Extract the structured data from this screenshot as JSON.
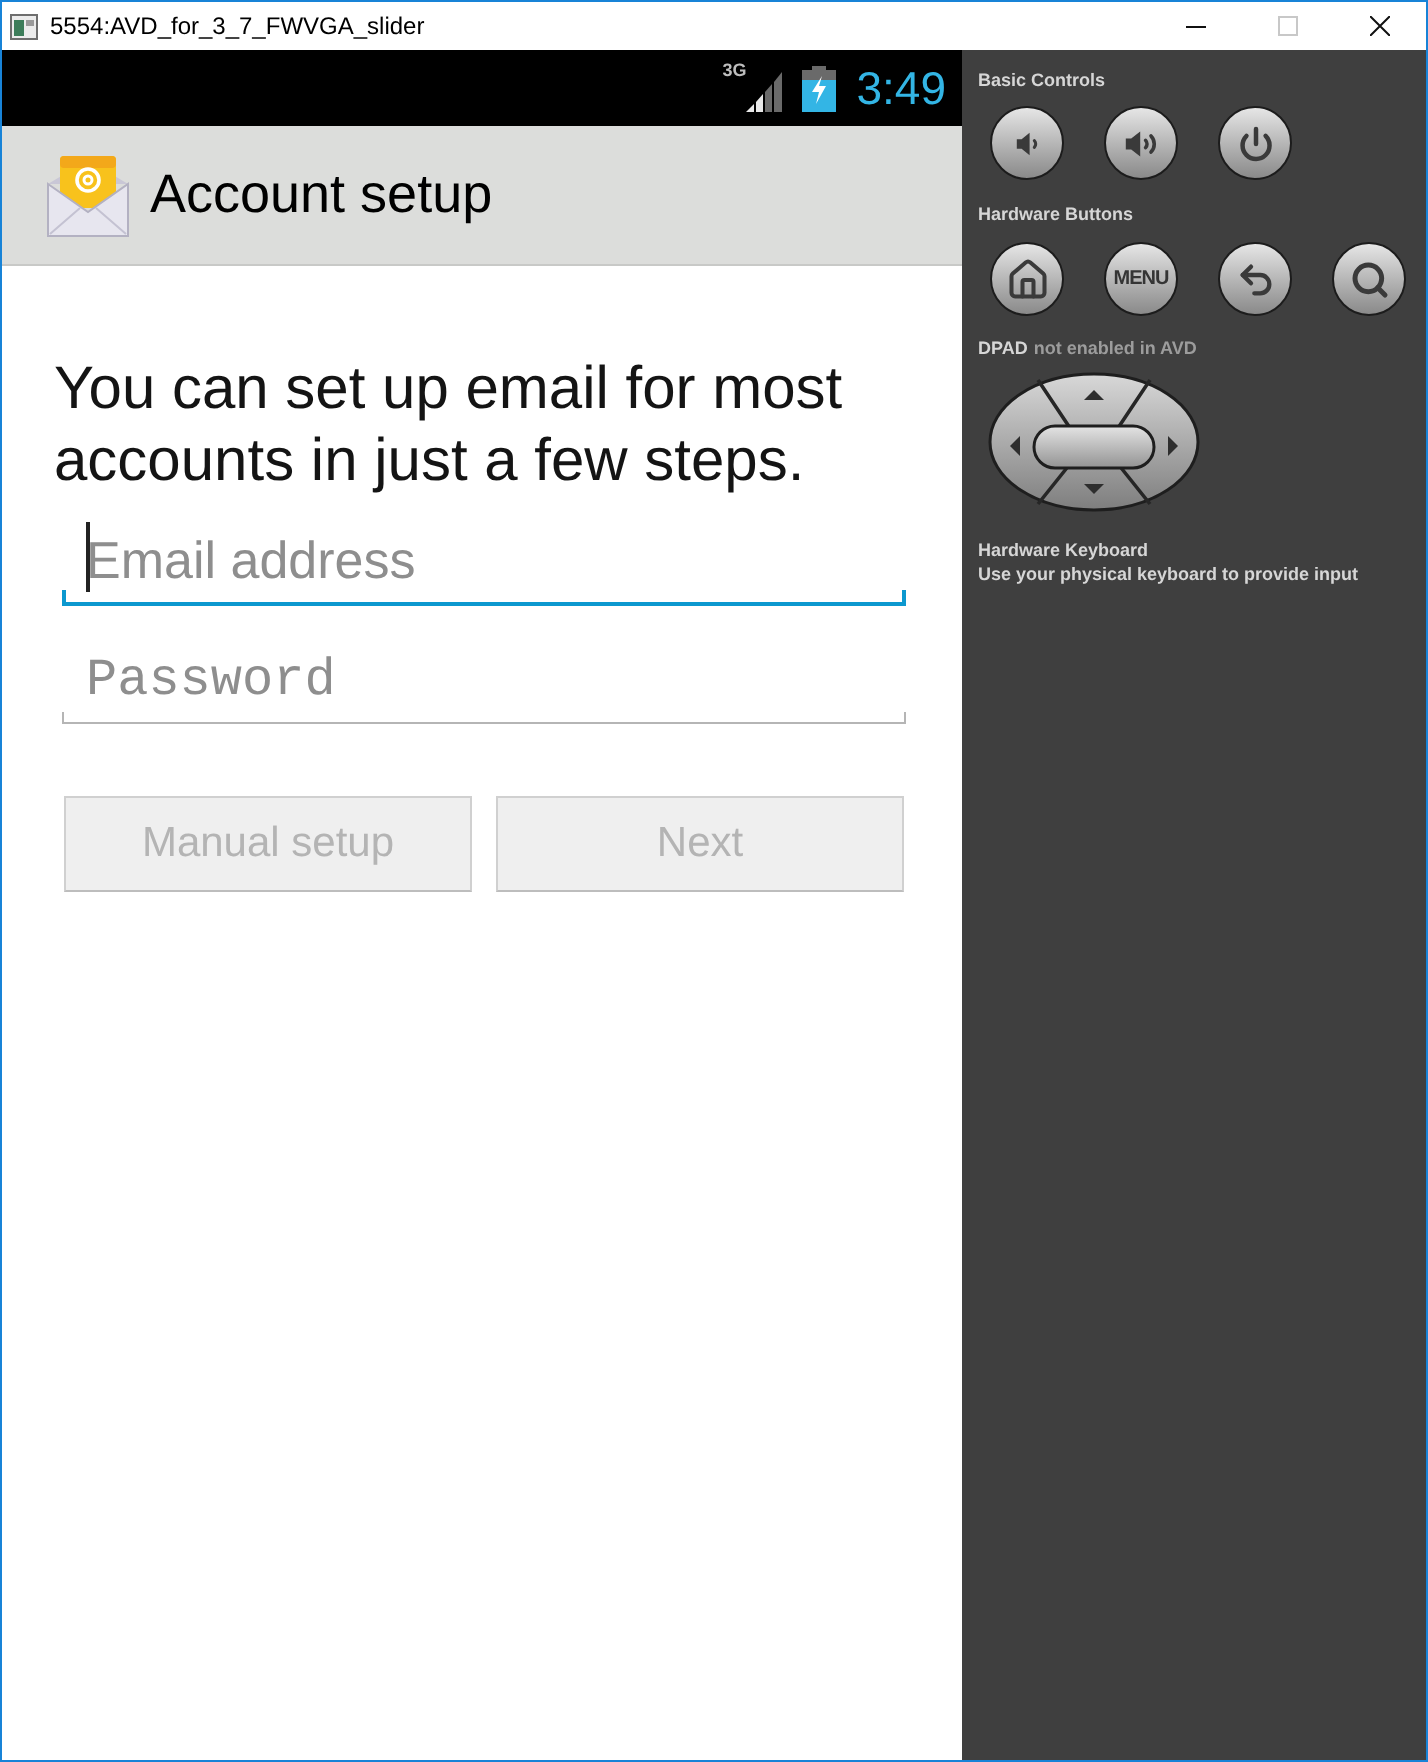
{
  "window": {
    "title": "5554:AVD_for_3_7_FWVGA_slider",
    "controls": [
      {
        "kind": "minimize",
        "disabled": false
      },
      {
        "kind": "maximize",
        "disabled": true
      },
      {
        "kind": "close",
        "disabled": false
      }
    ]
  },
  "status_bar": {
    "network": "3G",
    "time": "3:49"
  },
  "action_bar": {
    "title": "Account setup"
  },
  "intro": "You can set up email for most accounts in just a few steps.",
  "fields": [
    {
      "kind": "email",
      "placeholder": "Email address",
      "focused": true
    },
    {
      "kind": "password",
      "placeholder": "Password",
      "focused": false
    }
  ],
  "buttons": [
    {
      "label": "Manual setup",
      "disabled": true
    },
    {
      "label": "Next",
      "disabled": true
    }
  ],
  "controls_panel": {
    "basic_controls": {
      "title": "Basic Controls",
      "buttons": [
        {
          "kind": "volume_down"
        },
        {
          "kind": "volume_up"
        },
        {
          "kind": "power"
        }
      ]
    },
    "hardware_buttons": {
      "title": "Hardware Buttons",
      "buttons": [
        {
          "kind": "home"
        },
        {
          "kind": "label",
          "label": "MENU"
        },
        {
          "kind": "back"
        },
        {
          "kind": "search"
        }
      ]
    },
    "dpad": {
      "title": "DPAD",
      "note": "not enabled in AVD"
    },
    "keyboard": {
      "title": "Hardware Keyboard",
      "note": "Use your physical keyboard to provide input"
    }
  }
}
